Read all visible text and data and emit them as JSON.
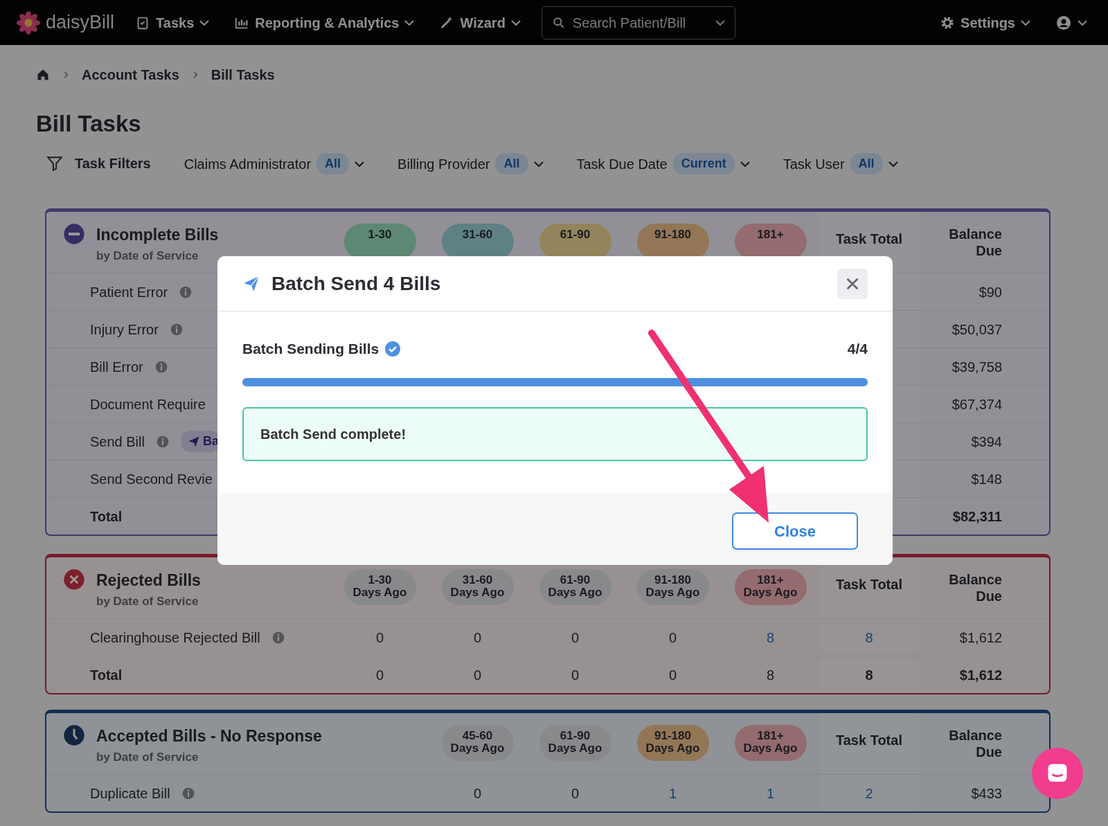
{
  "nav": {
    "brand": "daisy**Bill**",
    "menus": [
      {
        "kind": "tasks",
        "label": "Tasks"
      },
      {
        "kind": "reporting",
        "label": "Reporting & Analytics"
      },
      {
        "kind": "wizard",
        "label": "Wizard"
      }
    ],
    "search": {
      "placeholder": "Search Patient/Bill"
    },
    "settings": "Settings"
  },
  "breadcrumb": [
    "Account Tasks",
    "Bill Tasks"
  ],
  "title": "Bill Tasks",
  "filters": {
    "label": "Task Filters",
    "items": [
      {
        "label": "Claims Administrator",
        "value": "All"
      },
      {
        "label": "Billing Provider",
        "value": "All"
      },
      {
        "label": "Task Due Date",
        "value": "Current"
      },
      {
        "label": "Task User",
        "value": "All"
      }
    ]
  },
  "sections": [
    {
      "kind": "incomplete",
      "title": "Incomplete Bills",
      "subtitle": "by Date of Service",
      "task_total": "Task Total",
      "balance": "Balance Due",
      "ages": [
        {
          "label": "1-30",
          "color": "#5d8873"
        },
        {
          "label": "31-60",
          "color": "#5f8184"
        },
        {
          "label": "61-90",
          "color": "#93845b"
        },
        {
          "label": "91-180",
          "color": "#927655"
        },
        {
          "label": "181+",
          "color": "#946b6e"
        }
      ],
      "rows": [
        {
          "label": "Patient Error",
          "info": true,
          "balance": "$90"
        },
        {
          "label": "Injury Error",
          "info": true,
          "balance": "$50,037"
        },
        {
          "label": "Bill Error",
          "info": true,
          "balance": "$39,758"
        },
        {
          "label": "Document Require",
          "info": false,
          "balance": "$67,374"
        },
        {
          "label": "Send Bill",
          "info": true,
          "tag": "Ba",
          "balance": "$394"
        },
        {
          "label": "Send Second Revie",
          "info": false,
          "balance": "$148"
        },
        {
          "label": "Total",
          "info": false,
          "total": true,
          "balance": "$82,311"
        }
      ]
    },
    {
      "kind": "rejected",
      "title": "Rejected Bills",
      "subtitle": "by Date of Service",
      "task_total": "Task Total",
      "balance": "Balance Due",
      "ages": [
        {
          "label": "1-30",
          "sub": "Days Ago",
          "color": "#88898b"
        },
        {
          "label": "31-60",
          "sub": "Days Ago",
          "color": "#88898b"
        },
        {
          "label": "61-90",
          "sub": "Days Ago",
          "color": "#88898b"
        },
        {
          "label": "91-180",
          "sub": "Days Ago",
          "color": "#88898b"
        },
        {
          "label": "181+",
          "sub": "Days Ago",
          "color": "#946b6e"
        }
      ],
      "rows": [
        {
          "label": "Clearinghouse Rejected Bill",
          "info": true,
          "cells": [
            {
              "text": "0",
              "link": false
            },
            {
              "text": "0",
              "link": false
            },
            {
              "text": "0",
              "link": false
            },
            {
              "text": "0",
              "link": false
            },
            {
              "text": "8",
              "link": true
            }
          ],
          "count": {
            "text": "8",
            "link": true
          },
          "balance": "$1,612"
        },
        {
          "label": "Total",
          "info": false,
          "total": true,
          "cells": [
            {
              "text": "0",
              "link": false
            },
            {
              "text": "0",
              "link": false
            },
            {
              "text": "0",
              "link": false
            },
            {
              "text": "0",
              "link": false
            },
            {
              "text": "8",
              "link": false
            }
          ],
          "count": {
            "text": "8",
            "link": false
          },
          "balance": "$1,612"
        }
      ]
    },
    {
      "kind": "accepted",
      "title": "Accepted Bills - No Response",
      "subtitle": "by Date of Service",
      "task_total": "Task Total",
      "balance": "Balance Due",
      "ages": [
        {
          "label": "45-60",
          "sub": "Days Ago",
          "color": "#88898b"
        },
        {
          "label": "61-90",
          "sub": "Days Ago",
          "color": "#88898b"
        },
        {
          "label": "91-180",
          "sub": "Days Ago",
          "color": "#927655"
        },
        {
          "label": "181+",
          "sub": "Days Ago",
          "color": "#946b6e"
        }
      ],
      "rows": [
        {
          "label": "Duplicate Bill",
          "info": true,
          "cells": [
            {
              "text": "0",
              "link": false
            },
            {
              "text": "0",
              "link": false
            },
            {
              "text": "1",
              "link": true
            },
            {
              "text": "1",
              "link": true
            }
          ],
          "count": {
            "text": "2",
            "link": true
          },
          "balance": "$433"
        }
      ]
    }
  ],
  "modal": {
    "title": "Batch Send 4 Bills",
    "progress_label": "Batch Sending Bills",
    "done": true,
    "count": "4/4",
    "level": 1,
    "message": "Batch Send complete!",
    "button": "Close"
  }
}
